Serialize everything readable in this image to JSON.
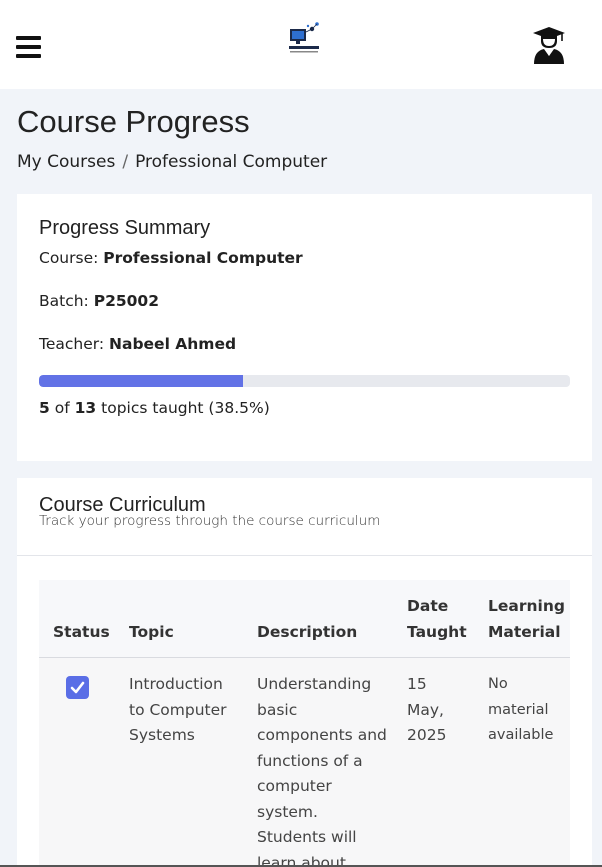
{
  "header": {
    "menu_icon": "hamburger-icon",
    "logo_icon": "computer-logo-icon",
    "avatar_icon": "graduate-avatar-icon"
  },
  "page": {
    "title": "Course Progress",
    "breadcrumb": {
      "parent": "My Courses",
      "separator": "/",
      "current": "Professional Computer"
    }
  },
  "summary": {
    "title": "Progress Summary",
    "course_label": "Course:",
    "course_value": "Professional Computer",
    "batch_label": "Batch:",
    "batch_value": "P25002",
    "teacher_label": "Teacher:",
    "teacher_value": "Nabeel Ahmed",
    "progress_fraction": 0.385,
    "taught": "5",
    "of_text": "of",
    "total": "13",
    "progress_suffix": "topics taught (38.5%)"
  },
  "curriculum": {
    "title": "Course Curriculum",
    "subtitle": "Track your progress through the course curriculum",
    "columns": {
      "status": "Status",
      "topic": "Topic",
      "description": "Description",
      "date_taught": "Date Taught",
      "learning_material": "Learning Material"
    },
    "rows": [
      {
        "status": "taught",
        "topic": "Introduction to Computer Systems",
        "description": "Understanding basic components and functions of a computer system. Students will learn about",
        "date": "15 May, 2025",
        "material": "No material available"
      }
    ]
  },
  "colors": {
    "accent": "#6272e6",
    "checkbox": "#5a6ee6",
    "page_bg": "#f1f4f9"
  }
}
